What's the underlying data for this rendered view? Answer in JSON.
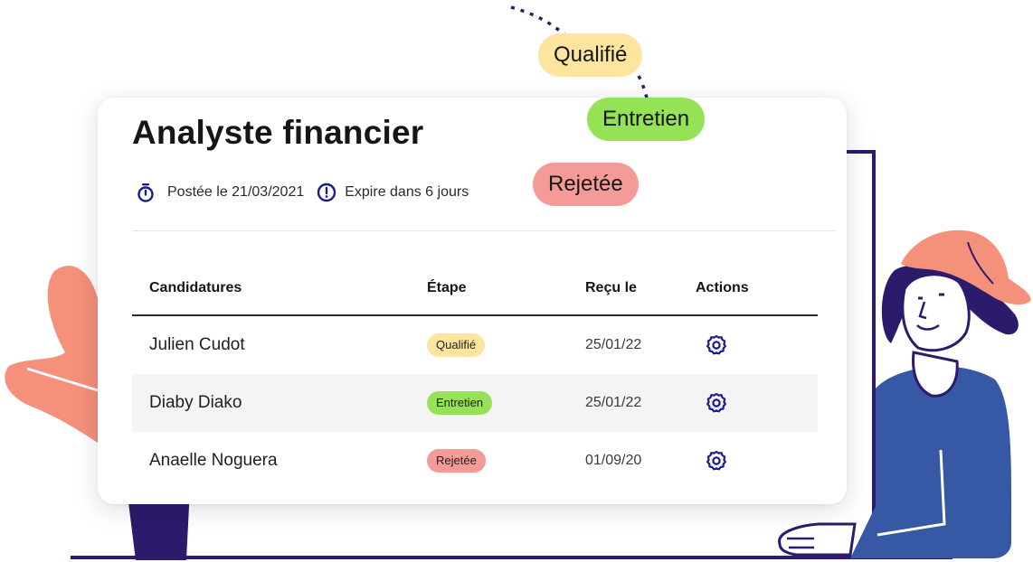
{
  "job": {
    "title": "Analyste financier",
    "posted": "Postée le 21/03/2021",
    "expires": "Expire dans 6 jours"
  },
  "table": {
    "headers": [
      "Candidatures",
      "Étape",
      "Reçu le",
      "Actions"
    ],
    "rows": [
      {
        "name": "Julien Cudot",
        "stage": "Qualifié",
        "received": "25/01/22"
      },
      {
        "name": "Diaby Diako",
        "stage": "Entretien",
        "received": "25/01/22"
      },
      {
        "name": "Anaelle Noguera",
        "stage": "Rejetée",
        "received": "01/09/20"
      }
    ]
  },
  "callouts": [
    "Qualifié",
    "Entretien",
    "Rejetée"
  ],
  "icons": {
    "posted": "stopwatch-icon",
    "expires": "alert-circle-icon",
    "action": "gear-icon"
  },
  "colors": {
    "qualified": "#fde5a0",
    "interview": "#95e257",
    "rejected": "#f49a97",
    "navy": "#1b1b8a",
    "coral": "#f5907a",
    "blue": "#3658a5",
    "dark_purple": "#2c1a6b"
  }
}
